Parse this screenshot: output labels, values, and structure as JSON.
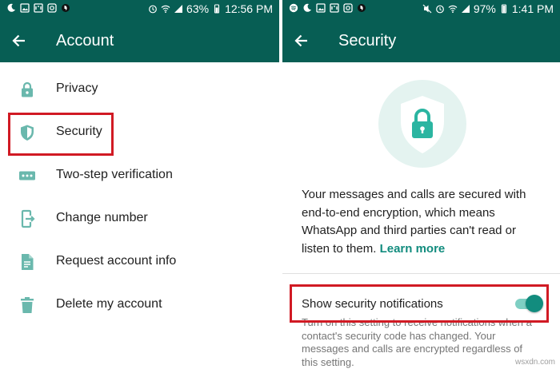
{
  "left": {
    "status": {
      "battery": "63%",
      "time": "12:56 PM"
    },
    "title": "Account",
    "items": [
      {
        "label": "Privacy",
        "icon": "lock-icon"
      },
      {
        "label": "Security",
        "icon": "shield-icon"
      },
      {
        "label": "Two-step verification",
        "icon": "dots-icon"
      },
      {
        "label": "Change number",
        "icon": "phone-transfer-icon"
      },
      {
        "label": "Request account info",
        "icon": "document-icon"
      },
      {
        "label": "Delete my account",
        "icon": "trash-icon"
      }
    ]
  },
  "right": {
    "status": {
      "battery": "97%",
      "time": "1:41 PM"
    },
    "title": "Security",
    "description": "Your messages and calls are secured with end-to-end encryption, which means WhatsApp and third parties can't read or listen to them.",
    "learn_more": "Learn more",
    "setting": {
      "title": "Show security notifications",
      "enabled": true,
      "description": "Turn on this setting to receive notifications when a contact's security code has changed. Your messages and calls are encrypted regardless of this setting."
    }
  },
  "watermark": "wsxdn.com",
  "colors": {
    "header": "#075e54",
    "icon": "#6ab8ad",
    "accent": "#128c7e",
    "highlight": "#d11a24"
  }
}
